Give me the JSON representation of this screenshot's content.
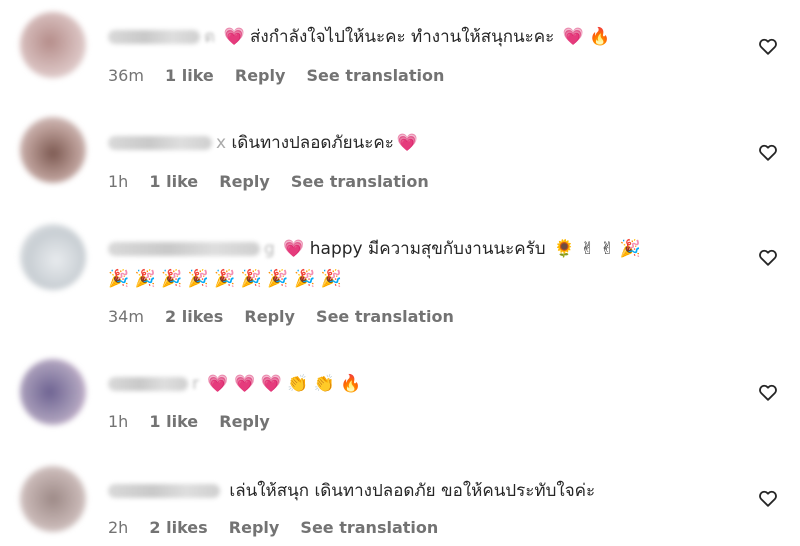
{
  "comments": [
    {
      "text": "ส่งกำลังใจไปให้นะคะ ทำงานให้สนุกนะคะ",
      "emoji_after": "💗 🔥",
      "emoji_before": "💗",
      "name_tail": "ต",
      "time": "36m",
      "likes": "1 like",
      "reply": "Reply",
      "translate": "See translation",
      "avatar_color": "#c9a9a6"
    },
    {
      "text": "เดินทางปลอดภัยนะคะ",
      "emoji_after": "💗",
      "emoji_before": "",
      "name_tail": "x",
      "time": "1h",
      "likes": "1 like",
      "reply": "Reply",
      "translate": "See translation",
      "avatar_color": "#b58e86"
    },
    {
      "text": "happy มีความสุขกับงานนะครับ",
      "emoji_after": "🌻 ✌ ✌ 🎉",
      "emoji_before": "💗",
      "line2": "🎉 🎉 🎉 🎉 🎉 🎉 🎉 🎉 🎉",
      "name_tail": "g",
      "time": "34m",
      "likes": "2 likes",
      "reply": "Reply",
      "translate": "See translation",
      "avatar_color": "#cfd3d6"
    },
    {
      "text": "",
      "emoji_after": "💗 💗 💗 👏 👏 🔥",
      "emoji_before": "",
      "name_tail": "r",
      "time": "1h",
      "likes": "1 like",
      "reply": "Reply",
      "translate": "",
      "avatar_color": "#8f86a8"
    },
    {
      "text": "เล่นให้สนุก เดินทางปลอดภัย ขอให้คนประทับใจค่ะ",
      "emoji_after": "",
      "emoji_before": "",
      "name_tail": "",
      "time": "2h",
      "likes": "2 likes",
      "reply": "Reply",
      "translate": "See translation",
      "avatar_color": "#b9aaa8"
    }
  ],
  "icons": {
    "like": "heart-outline-icon"
  },
  "colors": {
    "meta": "#737373",
    "text": "#262626"
  }
}
